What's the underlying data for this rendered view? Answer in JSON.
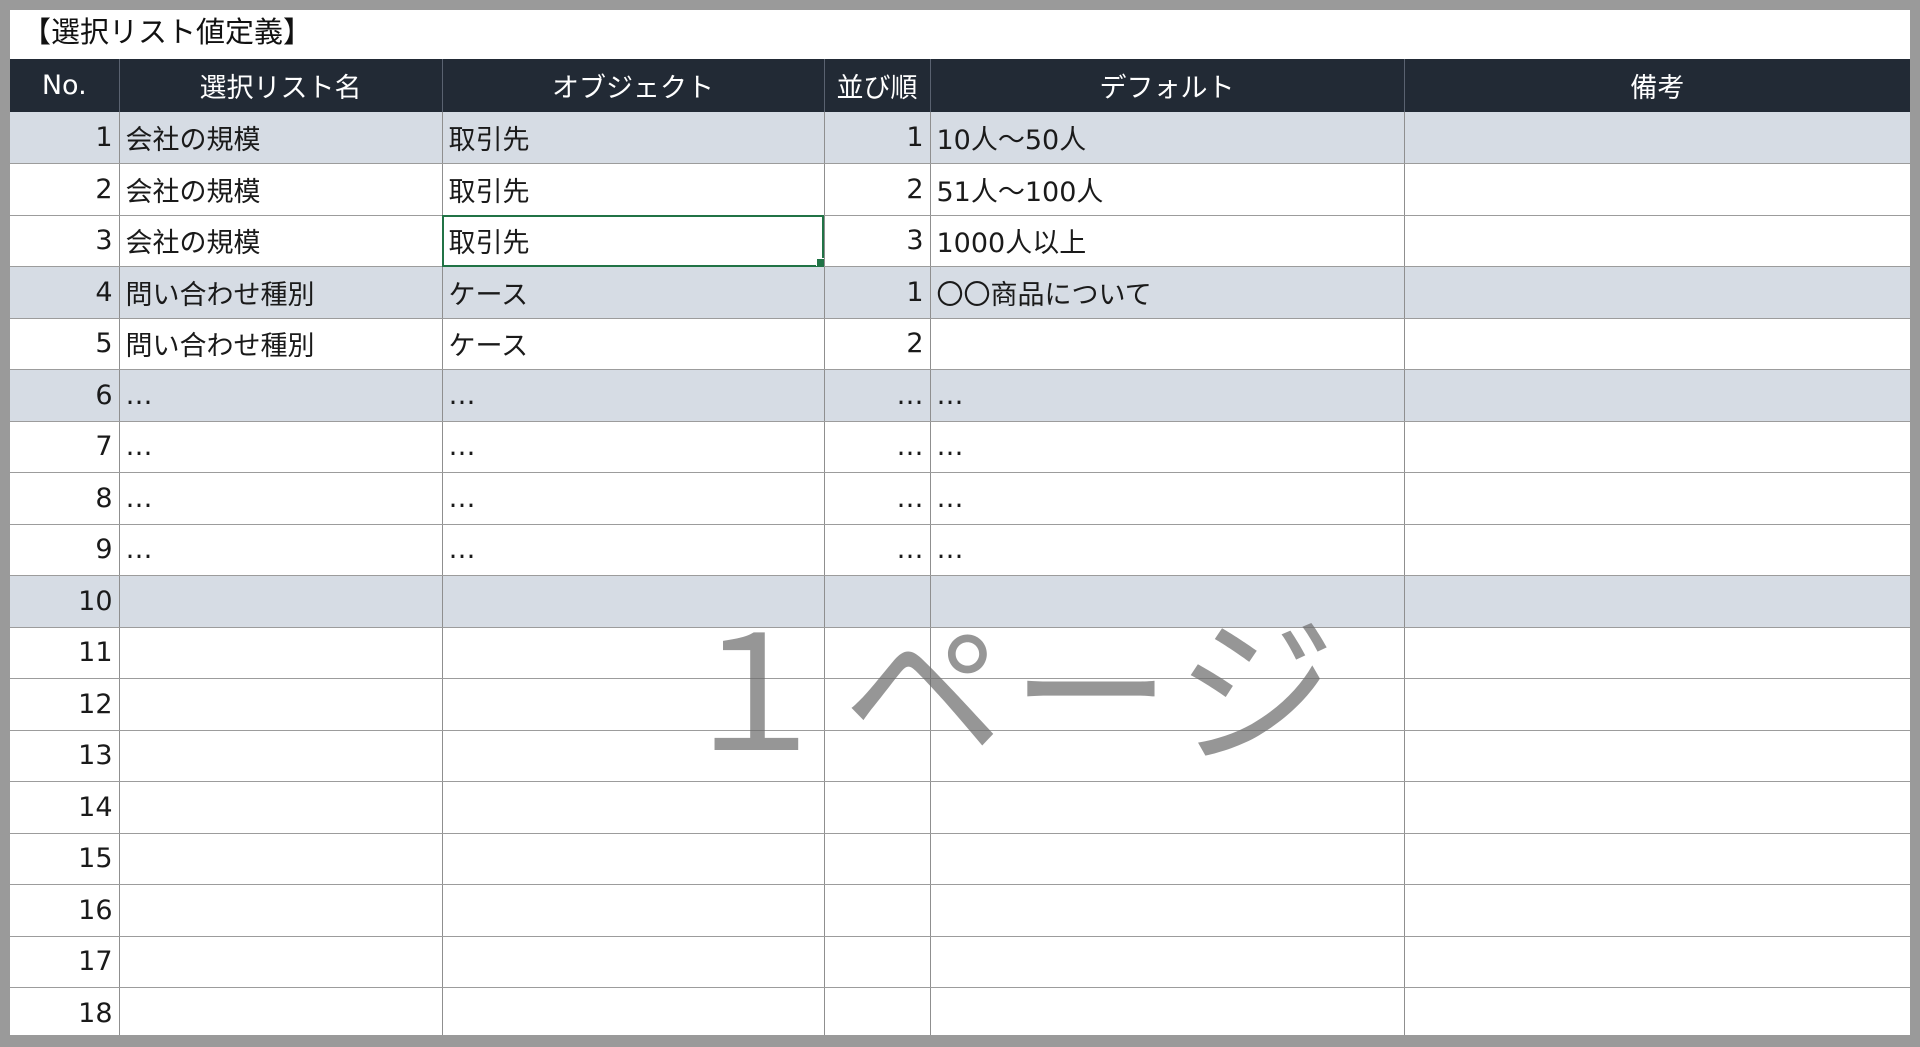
{
  "sheet": {
    "title": "【選択リスト値定義】",
    "watermark": "１ページ"
  },
  "columns": [
    "No.",
    "選択リスト名",
    "オブジェクト",
    "並び順",
    "デフォルト",
    "備考"
  ],
  "rows": [
    {
      "no": "1",
      "name": "会社の規模",
      "object": "取引先",
      "order": "1",
      "default": "10人～50人",
      "note": ""
    },
    {
      "no": "2",
      "name": "会社の規模",
      "object": "取引先",
      "order": "2",
      "default": "51人～100人",
      "note": ""
    },
    {
      "no": "3",
      "name": "会社の規模",
      "object": "取引先",
      "order": "3",
      "default": "1000人以上",
      "note": ""
    },
    {
      "no": "4",
      "name": "問い合わせ種別",
      "object": "ケース",
      "order": "1",
      "default": "〇〇商品について",
      "note": ""
    },
    {
      "no": "5",
      "name": "問い合わせ種別",
      "object": "ケース",
      "order": "2",
      "default": "",
      "note": ""
    },
    {
      "no": "6",
      "name": "…",
      "object": "…",
      "order": "…",
      "default": "…",
      "note": ""
    },
    {
      "no": "7",
      "name": "…",
      "object": "…",
      "order": "…",
      "default": "…",
      "note": ""
    },
    {
      "no": "8",
      "name": "…",
      "object": "…",
      "order": "…",
      "default": "…",
      "note": ""
    },
    {
      "no": "9",
      "name": "…",
      "object": "…",
      "order": "…",
      "default": "…",
      "note": ""
    },
    {
      "no": "10",
      "name": "",
      "object": "",
      "order": "",
      "default": "",
      "note": ""
    },
    {
      "no": "11",
      "name": "",
      "object": "",
      "order": "",
      "default": "",
      "note": ""
    },
    {
      "no": "12",
      "name": "",
      "object": "",
      "order": "",
      "default": "",
      "note": ""
    },
    {
      "no": "13",
      "name": "",
      "object": "",
      "order": "",
      "default": "",
      "note": ""
    },
    {
      "no": "14",
      "name": "",
      "object": "",
      "order": "",
      "default": "",
      "note": ""
    },
    {
      "no": "15",
      "name": "",
      "object": "",
      "order": "",
      "default": "",
      "note": ""
    },
    {
      "no": "16",
      "name": "",
      "object": "",
      "order": "",
      "default": "",
      "note": ""
    },
    {
      "no": "17",
      "name": "",
      "object": "",
      "order": "",
      "default": "",
      "note": ""
    },
    {
      "no": "18",
      "name": "",
      "object": "",
      "order": "",
      "default": "",
      "note": ""
    }
  ],
  "colors": {
    "header_bg": "#222a35",
    "band_bg": "#d6dce4",
    "selection": "#217346",
    "frame": "#9a9a9a"
  }
}
